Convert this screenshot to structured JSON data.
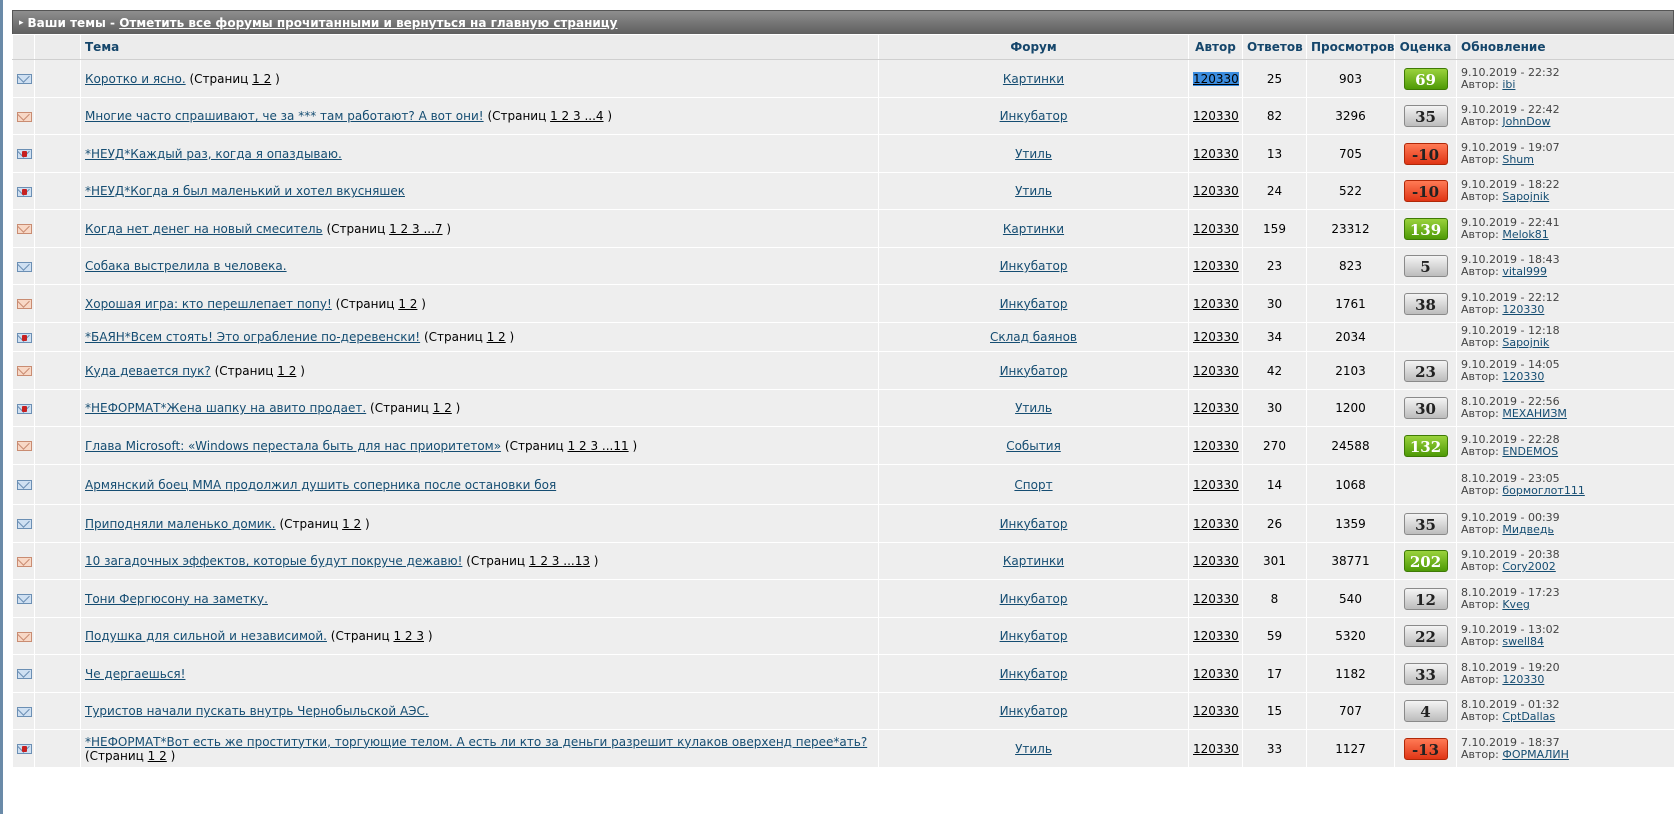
{
  "header": {
    "title": "Ваши темы",
    "separator": "-",
    "mark_read_link": "Отметить все форумы прочитанными и вернуться на главную страницу"
  },
  "columns": {
    "topic": "Тема",
    "forum": "Форум",
    "author": "Автор",
    "replies": "Ответов",
    "views": "Просмотров",
    "rating": "Оценка",
    "updated": "Обновление"
  },
  "labels": {
    "pages_prefix": "(Страниц",
    "pages_suffix": ")",
    "author_prefix": "Автор:"
  },
  "colors": {
    "header_gradient": "#6f6f6f",
    "link": "#154d72",
    "score_green": "#5aa80c",
    "score_red": "#f04a25",
    "score_grey": "#d5d5d5"
  },
  "rows": [
    {
      "icon": "normal",
      "title": "Коротко и ясно.",
      "pages": "1 2",
      "forum": "Картинки",
      "author": "120330",
      "selected": true,
      "replies": "25",
      "views": "903",
      "score": "69",
      "score_type": "green",
      "date": "9.10.2019 - 22:32",
      "last": "ibi"
    },
    {
      "icon": "hot",
      "title": "Многие часто спрашивают, че за *** там работают? А вот они!",
      "pages": "1 2 3 ...4",
      "forum": "Инкубатор",
      "author": "120330",
      "replies": "82",
      "views": "3296",
      "score": "35",
      "score_type": "grey",
      "date": "9.10.2019 - 22:42",
      "last": "JohnDow"
    },
    {
      "icon": "lock",
      "title": "*НЕУД*Каждый раз, когда я опаздываю.",
      "pages": "",
      "forum": "Утиль",
      "author": "120330",
      "replies": "13",
      "views": "705",
      "score": "-10",
      "score_type": "red",
      "date": "9.10.2019 - 19:07",
      "last": "Shum"
    },
    {
      "icon": "lock",
      "title": "*НЕУД*Когда я был маленький и хотел вкусняшек",
      "pages": "",
      "forum": "Утиль",
      "author": "120330",
      "replies": "24",
      "views": "522",
      "score": "-10",
      "score_type": "red",
      "date": "9.10.2019 - 18:22",
      "last": "Sapojnik"
    },
    {
      "icon": "hot",
      "title": "Когда нет денег на новый смеситель",
      "pages": "1 2 3 ...7",
      "forum": "Картинки",
      "author": "120330",
      "replies": "159",
      "views": "23312",
      "score": "139",
      "score_type": "green",
      "date": "9.10.2019 - 22:41",
      "last": "Melok81"
    },
    {
      "icon": "normal",
      "title": "Собака выстрелила в человека.",
      "pages": "",
      "forum": "Инкубатор",
      "author": "120330",
      "replies": "23",
      "views": "823",
      "score": "5",
      "score_type": "grey",
      "date": "9.10.2019 - 18:43",
      "last": "vital999"
    },
    {
      "icon": "hot",
      "title": "Хорошая игра: кто перешлепает попу!",
      "pages": "1 2",
      "forum": "Инкубатор",
      "author": "120330",
      "replies": "30",
      "views": "1761",
      "score": "38",
      "score_type": "grey",
      "date": "9.10.2019 - 22:12",
      "last": "120330"
    },
    {
      "icon": "lock",
      "title": "*БАЯН*Всем стоять! Это ограбление по-деревенски!",
      "pages": "1 2",
      "forum": "Склад баянов",
      "author": "120330",
      "replies": "34",
      "views": "2034",
      "score": "",
      "score_type": "none",
      "date": "9.10.2019 - 12:18",
      "last": "Sapojnik"
    },
    {
      "icon": "hot",
      "title": "Куда девается пук?",
      "pages": "1 2",
      "forum": "Инкубатор",
      "author": "120330",
      "replies": "42",
      "views": "2103",
      "score": "23",
      "score_type": "grey",
      "date": "9.10.2019 - 14:05",
      "last": "120330"
    },
    {
      "icon": "lock",
      "title": "*НЕФОРМАТ*Жена шапку на авито продает.",
      "pages": "1 2",
      "forum": "Утиль",
      "author": "120330",
      "replies": "30",
      "views": "1200",
      "score": "30",
      "score_type": "grey",
      "date": "8.10.2019 - 22:56",
      "last": "МЕХАНИЗМ"
    },
    {
      "icon": "hot",
      "title": "Глава Microsoft: «Windows перестала быть для нас приоритетом»",
      "pages": "1 2 3 ...11",
      "forum": "События",
      "author": "120330",
      "replies": "270",
      "views": "24588",
      "score": "132",
      "score_type": "green",
      "date": "9.10.2019 - 22:28",
      "last": "ENDEMOS"
    },
    {
      "icon": "normal",
      "title": "Армянский боец ММА продолжил душить соперника после остановки боя",
      "pages": "",
      "forum": "Спорт",
      "author": "120330",
      "replies": "14",
      "views": "1068",
      "score": "",
      "score_type": "none",
      "date": "8.10.2019 - 23:05",
      "last": "бормоглот111"
    },
    {
      "icon": "normal",
      "title": "Приподняли маленько домик.",
      "pages": "1 2",
      "forum": "Инкубатор",
      "author": "120330",
      "replies": "26",
      "views": "1359",
      "score": "35",
      "score_type": "grey",
      "date": "9.10.2019 - 00:39",
      "last": "Мидведь"
    },
    {
      "icon": "hot",
      "title": "10 загадочных эффектов, которые будут покруче дежавю!",
      "pages": "1 2 3 ...13",
      "forum": "Картинки",
      "author": "120330",
      "replies": "301",
      "views": "38771",
      "score": "202",
      "score_type": "green",
      "date": "9.10.2019 - 20:38",
      "last": "Cory2002"
    },
    {
      "icon": "normal",
      "title": "Тони Фергюсону на заметку.",
      "pages": "",
      "forum": "Инкубатор",
      "author": "120330",
      "replies": "8",
      "views": "540",
      "score": "12",
      "score_type": "grey",
      "date": "8.10.2019 - 17:23",
      "last": "Kveg"
    },
    {
      "icon": "hot",
      "title": "Подушка для сильной и независимой.",
      "pages": "1 2 3",
      "forum": "Инкубатор",
      "author": "120330",
      "replies": "59",
      "views": "5320",
      "score": "22",
      "score_type": "grey",
      "date": "9.10.2019 - 13:02",
      "last": "swell84"
    },
    {
      "icon": "normal",
      "title": "Че дергаешься!",
      "pages": "",
      "forum": "Инкубатор",
      "author": "120330",
      "replies": "17",
      "views": "1182",
      "score": "33",
      "score_type": "grey",
      "date": "8.10.2019 - 19:20",
      "last": "120330"
    },
    {
      "icon": "normal",
      "title": "Туристов начали пускать внутрь Чернобыльской АЭС.",
      "pages": "",
      "forum": "Инкубатор",
      "author": "120330",
      "replies": "15",
      "views": "707",
      "score": "4",
      "score_type": "grey",
      "date": "8.10.2019 - 01:32",
      "last": "CptDallas"
    },
    {
      "icon": "lock",
      "title": "*НЕФОРМАТ*Вот есть же проститутки, торгующие телом. А есть ли кто за деньги разрешит кулаков оверхенд перее*ать?",
      "pages": "1 2",
      "forum": "Утиль",
      "author": "120330",
      "replies": "33",
      "views": "1127",
      "score": "-13",
      "score_type": "red",
      "date": "7.10.2019 - 18:37",
      "last": "ФОРМАЛИН"
    }
  ]
}
